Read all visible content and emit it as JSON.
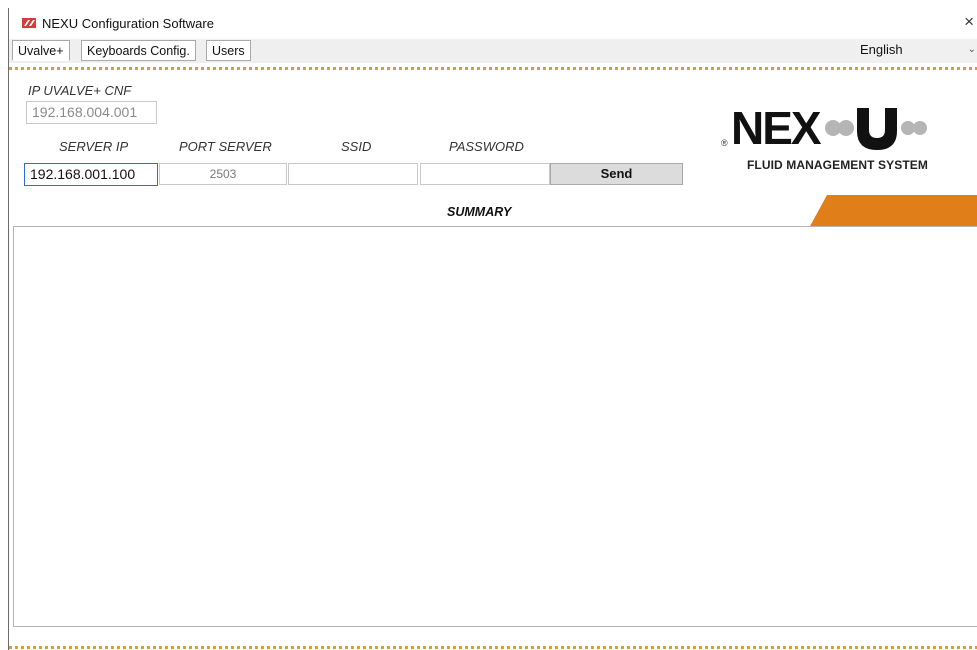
{
  "window": {
    "title": "NEXU Configuration Software",
    "close_icon": "×"
  },
  "tabs": [
    {
      "label": "Uvalve+"
    },
    {
      "label": "Keyboards Config."
    },
    {
      "label": "Users"
    }
  ],
  "language": {
    "selected": "English",
    "chevron_icon": "chevron-down-icon"
  },
  "ip_section": {
    "label": "IP UVALVE+ CNF",
    "value": "192.168.004.001"
  },
  "network": {
    "server_ip_label": "SERVER IP",
    "port_label": "PORT SERVER",
    "ssid_label": "SSID",
    "password_label": "PASSWORD",
    "server_ip_value": "192.168.001.100",
    "port_value": "2503",
    "ssid_value": "",
    "password_value": "",
    "send_label": "Send"
  },
  "logo": {
    "text": "NEXU",
    "subtitle": "FLUID MANAGEMENT SYSTEM"
  },
  "summary": {
    "title": "SUMMARY",
    "content": ""
  },
  "colors": {
    "accent": "#e07f1a",
    "dots": "#e39a2d",
    "focus": "#2e6bd3"
  }
}
